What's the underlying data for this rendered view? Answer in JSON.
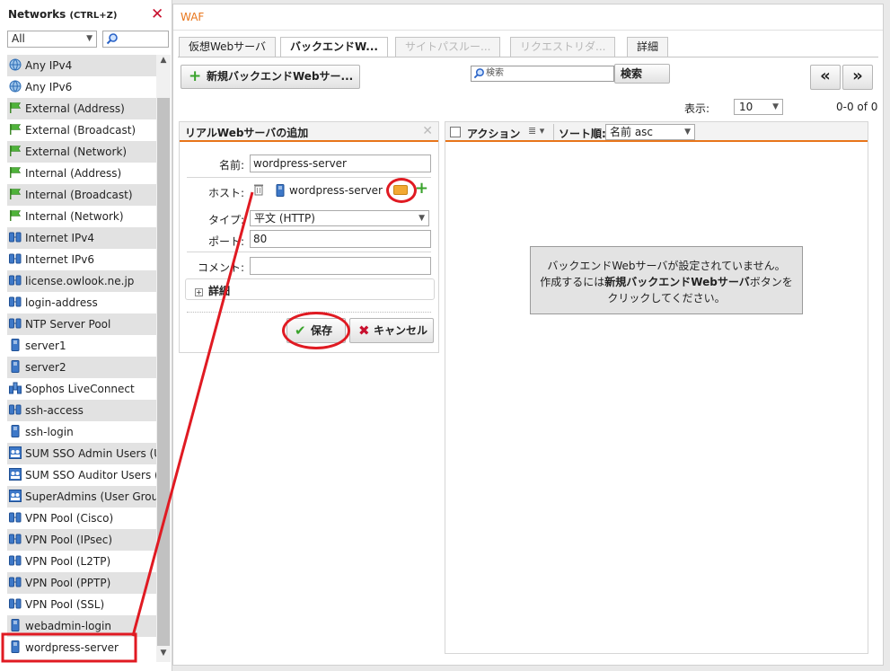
{
  "left": {
    "title": "Networks",
    "shortcut": "(CTRL+Z)",
    "filter_value": "All",
    "items": [
      {
        "label": "Any IPv4",
        "icon": "globe-icon"
      },
      {
        "label": "Any IPv6",
        "icon": "globe-icon"
      },
      {
        "label": "External (Address)",
        "icon": "flag-icon"
      },
      {
        "label": "External (Broadcast)",
        "icon": "flag-icon"
      },
      {
        "label": "External (Network)",
        "icon": "flag-icon"
      },
      {
        "label": "Internal (Address)",
        "icon": "flag-icon"
      },
      {
        "label": "Internal (Broadcast)",
        "icon": "flag-icon"
      },
      {
        "label": "Internal (Network)",
        "icon": "flag-icon"
      },
      {
        "label": "Internet IPv4",
        "icon": "network-icon"
      },
      {
        "label": "Internet IPv6",
        "icon": "network-icon"
      },
      {
        "label": "license.owlook.ne.jp",
        "icon": "network-icon"
      },
      {
        "label": "login-address",
        "icon": "network-icon"
      },
      {
        "label": "NTP Server Pool",
        "icon": "network-icon"
      },
      {
        "label": "server1",
        "icon": "server-icon"
      },
      {
        "label": "server2",
        "icon": "server-icon"
      },
      {
        "label": "Sophos LiveConnect",
        "icon": "cluster-icon"
      },
      {
        "label": "ssh-access",
        "icon": "network-icon"
      },
      {
        "label": "ssh-login",
        "icon": "server-icon"
      },
      {
        "label": "SUM SSO Admin Users (Us",
        "icon": "users-icon"
      },
      {
        "label": "SUM SSO Auditor Users (U",
        "icon": "users-icon"
      },
      {
        "label": "SuperAdmins (User Group",
        "icon": "users-icon"
      },
      {
        "label": "VPN Pool (Cisco)",
        "icon": "network-icon"
      },
      {
        "label": "VPN Pool (IPsec)",
        "icon": "network-icon"
      },
      {
        "label": "VPN Pool (L2TP)",
        "icon": "network-icon"
      },
      {
        "label": "VPN Pool (PPTP)",
        "icon": "network-icon"
      },
      {
        "label": "VPN Pool (SSL)",
        "icon": "network-icon"
      },
      {
        "label": "webadmin-login",
        "icon": "server-icon"
      },
      {
        "label": "wordpress-server",
        "icon": "server-icon"
      }
    ]
  },
  "main": {
    "section": "WAF",
    "tabs": [
      {
        "label": "仮想Webサーバ",
        "state": "normal"
      },
      {
        "label": "バックエンドW...",
        "state": "active"
      },
      {
        "label": "サイトパスルー...",
        "state": "disabled"
      },
      {
        "label": "リクエストリダ...",
        "state": "disabled"
      },
      {
        "label": "詳細",
        "state": "normal"
      }
    ],
    "new_button": "新規バックエンドWebサー...",
    "search_placeholder": "検索",
    "search_button": "検索",
    "prev_label": "«",
    "next_label": "»",
    "display_label": "表示:",
    "display_value": "10",
    "page_count": "0-0 of 0"
  },
  "form": {
    "title": "リアルWebサーバの追加",
    "name_label": "名前:",
    "name_value": "wordpress-server",
    "host_label": "ホスト:",
    "host_value": "wordpress-server",
    "type_label": "タイプ:",
    "type_value": "平文 (HTTP)",
    "port_label": "ポート:",
    "port_value": "80",
    "comment_label": "コメント:",
    "comment_value": "",
    "detail_label": "詳細",
    "save_label": "保存",
    "cancel_label": "キャンセル"
  },
  "list": {
    "action_label": "アクション",
    "sort_label": "ソート順:",
    "sort_value": "名前 asc",
    "empty_line1": "バックエンドWebサーバが設定されていません。",
    "empty_line2_pre": "作成するには",
    "empty_line2_bold": "新規バックエンドWebサーバ",
    "empty_line2_post": "ボタンを",
    "empty_line3": "クリックしてください。"
  },
  "colors": {
    "accent_orange": "#e8751a",
    "annotation_red": "#e01a22",
    "add_green": "#3aa32c"
  }
}
